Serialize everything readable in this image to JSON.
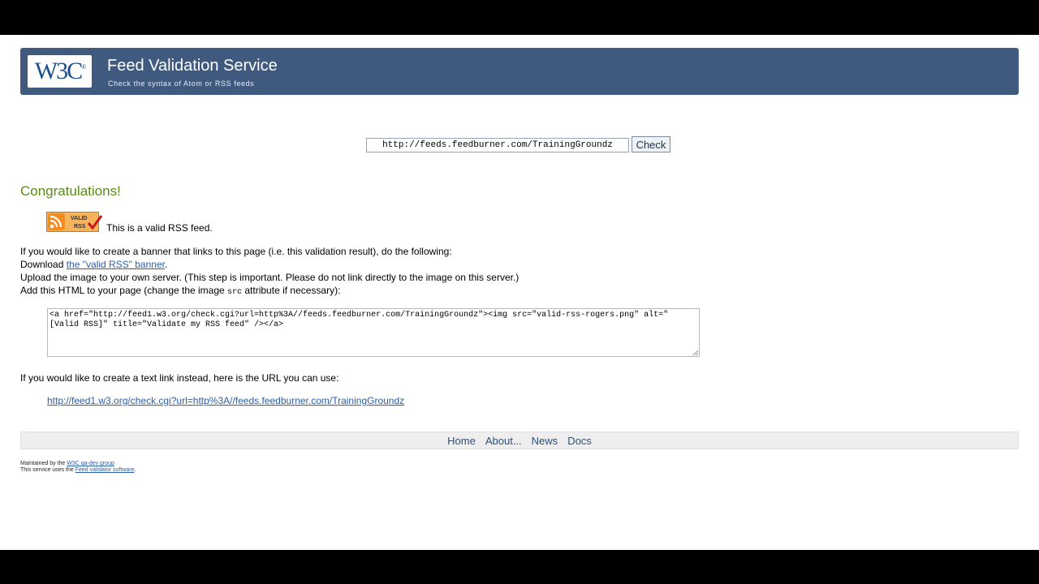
{
  "header": {
    "logo_text": "W3C",
    "logo_reg": "®",
    "title": "Feed Validation Service",
    "subtitle": "Check the syntax of Atom or RSS feeds"
  },
  "form": {
    "url_value": "http://feeds.feedburner.com/TrainingGroundz",
    "check_label": "Check"
  },
  "result": {
    "congrats": "Congratulations!",
    "badge_line1": "VALID",
    "badge_line2": "RSS",
    "valid_text": "This is a valid RSS feed."
  },
  "instructions": {
    "line1": "If you would like to create a banner that links to this page (i.e. this validation result), do the following:",
    "download_prefix": "Download ",
    "download_link": "the \"valid RSS\" banner",
    "download_suffix": ".",
    "upload": "Upload the image to your own server. (This step is important. Please do not link directly to the image on this server.)",
    "add_prefix": "Add this HTML to your page (change the image ",
    "add_code": "src",
    "add_suffix": " attribute if necessary):",
    "snippet": "<a href=\"http://feed1.w3.org/check.cgi?url=http%3A//feeds.feedburner.com/TrainingGroundz\"><img src=\"valid-rss-rogers.png\" alt=\"[Valid RSS]\" title=\"Validate my RSS feed\" /></a>",
    "text_link_intro": "If you would like to create a text link instead, here is the URL you can use:",
    "text_link": "http://feed1.w3.org/check.cgi?url=http%3A//feeds.feedburner.com/TrainingGroundz"
  },
  "footer": {
    "links": [
      "Home",
      "About...",
      "News",
      "Docs"
    ],
    "maintained_prefix": "Maintained by the ",
    "maintained_link": "W3C qa-dev group",
    "uses_prefix": "This service uses the ",
    "uses_link": "Feed validator software",
    "uses_suffix": "."
  },
  "colors": {
    "banner": "#3f5a7e",
    "congrats": "#5b8a19",
    "link": "#2a5ea8",
    "rss_orange": "#f7931e"
  }
}
